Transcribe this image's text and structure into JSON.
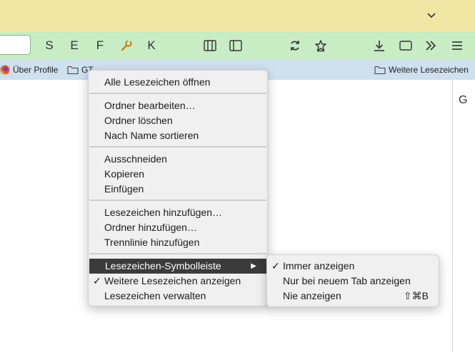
{
  "toolbar": {
    "letters": [
      "S",
      "E",
      "F",
      "K"
    ]
  },
  "bookmarks_bar": {
    "items": [
      {
        "label": "Über Profile",
        "icon": "firefox-icon"
      },
      {
        "label": "GT",
        "icon": "folder-icon"
      }
    ],
    "more_label": "Weitere Lesezeichen"
  },
  "sidebar": {
    "letter": "G"
  },
  "context_menu": {
    "open_all": "Alle Lesezeichen öffnen",
    "edit_folder": "Ordner bearbeiten…",
    "delete_folder": "Ordner löschen",
    "sort_by_name": "Nach Name sortieren",
    "cut": "Ausschneiden",
    "copy": "Kopieren",
    "paste": "Einfügen",
    "add_bookmark": "Lesezeichen hinzufügen…",
    "add_folder": "Ordner hinzufügen…",
    "add_separator": "Trennlinie hinzufügen",
    "toolbar_submenu": "Lesezeichen-Symbolleiste",
    "show_other": "Weitere Lesezeichen anzeigen",
    "manage": "Lesezeichen verwalten",
    "check": "✓",
    "arrow": "▶"
  },
  "submenu": {
    "always_show": "Immer anzeigen",
    "new_tab_only": "Nur bei neuem Tab anzeigen",
    "never_show": "Nie anzeigen",
    "shortcut": "⇧⌘B",
    "check": "✓"
  }
}
